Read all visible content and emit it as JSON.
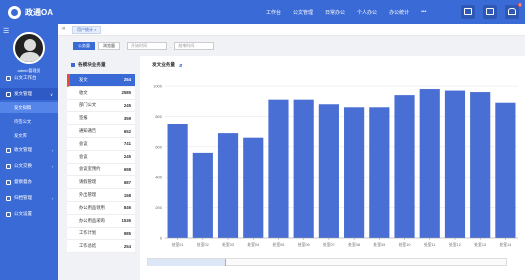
{
  "app": {
    "title": "政通OA"
  },
  "topnav": [
    "工作台",
    "公文管理",
    "日常办公",
    "个人办公",
    "办公统计",
    "•••"
  ],
  "top_badges": {
    "mail": "",
    "bell": "8"
  },
  "user": {
    "name": "admin管理员"
  },
  "sidebar": {
    "items": [
      {
        "label": "公文工作台"
      },
      {
        "label": "发文管理"
      },
      {
        "label": "收文管理"
      },
      {
        "label": "公文交换"
      },
      {
        "label": "督察督办"
      },
      {
        "label": "归档管理"
      },
      {
        "label": "公文设置"
      }
    ],
    "subs": [
      "发文拟稿",
      "待签公文",
      "发文库"
    ]
  },
  "tabs": [
    {
      "label": "用户统计 ×"
    }
  ],
  "buttons": {
    "btn1": "公务量",
    "btn2": "浏览量",
    "start_placeholder": "开始时间",
    "sep": "-",
    "end_placeholder": "结束时间"
  },
  "left_panel": {
    "title": "各模块业务量",
    "rows": [
      {
        "label": "发文",
        "value": "254"
      },
      {
        "label": "收文",
        "value": "2585"
      },
      {
        "label": "部门公文",
        "value": "245"
      },
      {
        "label": "签报",
        "value": "359"
      },
      {
        "label": "通知通告",
        "value": "652"
      },
      {
        "label": "会议",
        "value": "741"
      },
      {
        "label": "会议",
        "value": "245"
      },
      {
        "label": "会议室预约",
        "value": "698"
      },
      {
        "label": "请假管理",
        "value": "687"
      },
      {
        "label": "外出管理",
        "value": "158"
      },
      {
        "label": "办公用品领用",
        "value": "846"
      },
      {
        "label": "办公用品采购",
        "value": "1536"
      },
      {
        "label": "工作计划",
        "value": "985"
      },
      {
        "label": "工作总结",
        "value": "254"
      }
    ]
  },
  "chart_data": {
    "type": "bar",
    "title": "发文业务量",
    "categories": [
      "处室01",
      "处室02",
      "处室03",
      "处室04",
      "处室05",
      "处室06",
      "处室07",
      "处室08",
      "处室09",
      "处室10",
      "处室11",
      "处室12",
      "处室13",
      "处室14"
    ],
    "values": [
      750,
      560,
      690,
      660,
      910,
      910,
      880,
      860,
      860,
      940,
      980,
      970,
      960,
      890
    ],
    "ylim": [
      0,
      1000
    ],
    "yticks": [
      0,
      200,
      400,
      600,
      800,
      1000
    ],
    "bar_color": "#4a6fd4",
    "grid": true
  },
  "colors": {
    "accent": "#3a6ad6",
    "alert": "#e74c3c"
  }
}
